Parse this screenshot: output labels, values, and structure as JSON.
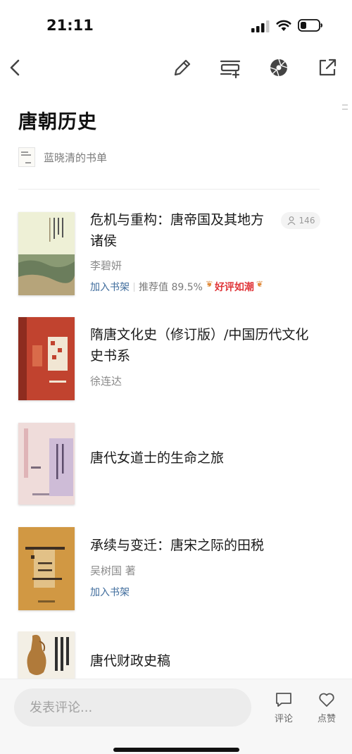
{
  "status_bar": {
    "time": "21:11"
  },
  "toolbar": {
    "icons": [
      "back-icon",
      "edit-icon",
      "add-to-list-icon",
      "shutter-icon",
      "export-icon"
    ]
  },
  "header": {
    "title": "唐朝历史",
    "owner": "蓝晓清的书单"
  },
  "books": [
    {
      "title": "危机与重构：唐帝国及其地方诸侯",
      "author": "李碧妍",
      "readers": "146",
      "add_label": "加入书架",
      "rec_label": "推荐值 89.5%",
      "badge": "好评如潮"
    },
    {
      "title": "隋唐文化史（修订版）/中国历代文化史书系",
      "author": "徐连达"
    },
    {
      "title": "唐代女道士的生命之旅"
    },
    {
      "title": "承续与变迁：唐宋之际的田税",
      "author": "吴树国 著",
      "add_label": "加入书架"
    },
    {
      "title": "唐代财政史稿"
    }
  ],
  "bottom_bar": {
    "comment_placeholder": "发表评论...",
    "comment_label": "评论",
    "like_label": "点赞"
  },
  "colors": {
    "link_blue": "#3f6c9c",
    "badge_red": "#e0363a",
    "muted_text": "#8a8a8a"
  }
}
